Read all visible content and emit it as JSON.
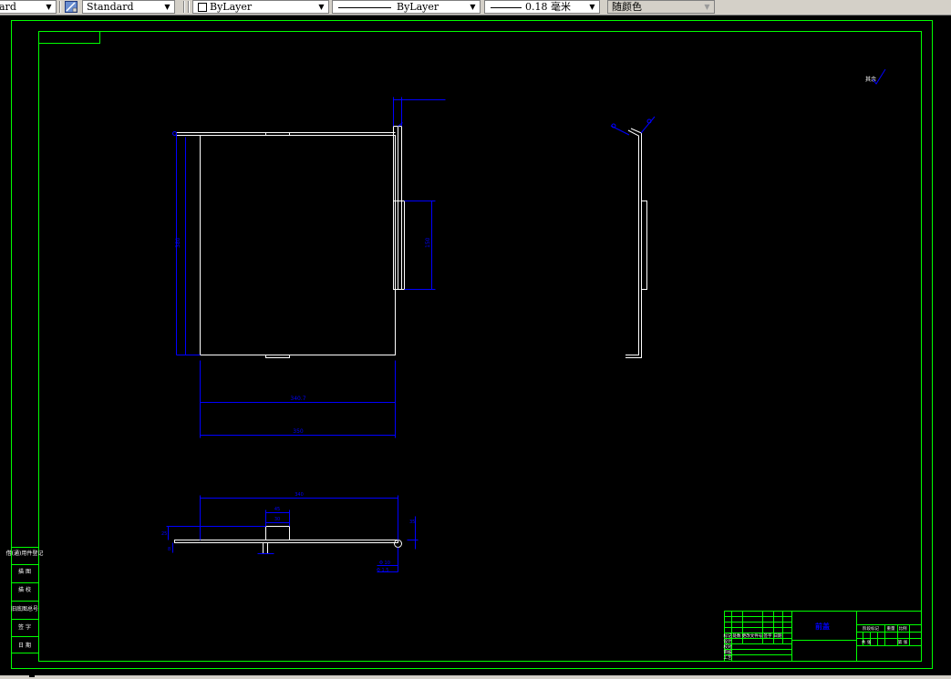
{
  "toolbar": {
    "textstyle": {
      "value": "ard"
    },
    "dimstyle": {
      "value": "Standard"
    },
    "layer": {
      "value": "ByLayer"
    },
    "linetype": {
      "value": "ByLayer"
    },
    "lineweight": {
      "value": "0.18 毫米"
    },
    "color": {
      "value": "随颜色"
    },
    "icons": {
      "dimstyle": "dimension-style-icon",
      "arrow": "chevron-down-icon"
    }
  },
  "drawing": {
    "colors": {
      "frame": "#00ff00",
      "geometry": "#ffffff",
      "dimension": "#0000ff",
      "label": "#0000ff"
    },
    "dims": {
      "front_height": "380",
      "flange": "150",
      "width_inner": "340.7",
      "width_outer": "350",
      "section_width": "340",
      "section_small": "45",
      "section_small2": "30",
      "section_left_h": "25",
      "section_left_v": "8",
      "section_right_h": "35",
      "section_hole_a": "Φ 10",
      "section_hole_b": "Φ 1.5"
    },
    "symbols": {
      "roughness": "其余",
      "title": "前盖"
    },
    "side_labels": [
      "借(通)用件登记",
      "描 图",
      "描 校",
      "旧底图总号",
      "签 字",
      "日 期"
    ],
    "title_block": {
      "rows": [
        "设计",
        "校对",
        "审核",
        "工艺",
        "批准"
      ],
      "header": [
        "标记",
        "处数",
        "更改文件号",
        "签字",
        "日期"
      ],
      "right": [
        "阶段标记",
        "重量",
        "比例",
        "共 张",
        "第 张"
      ]
    }
  }
}
